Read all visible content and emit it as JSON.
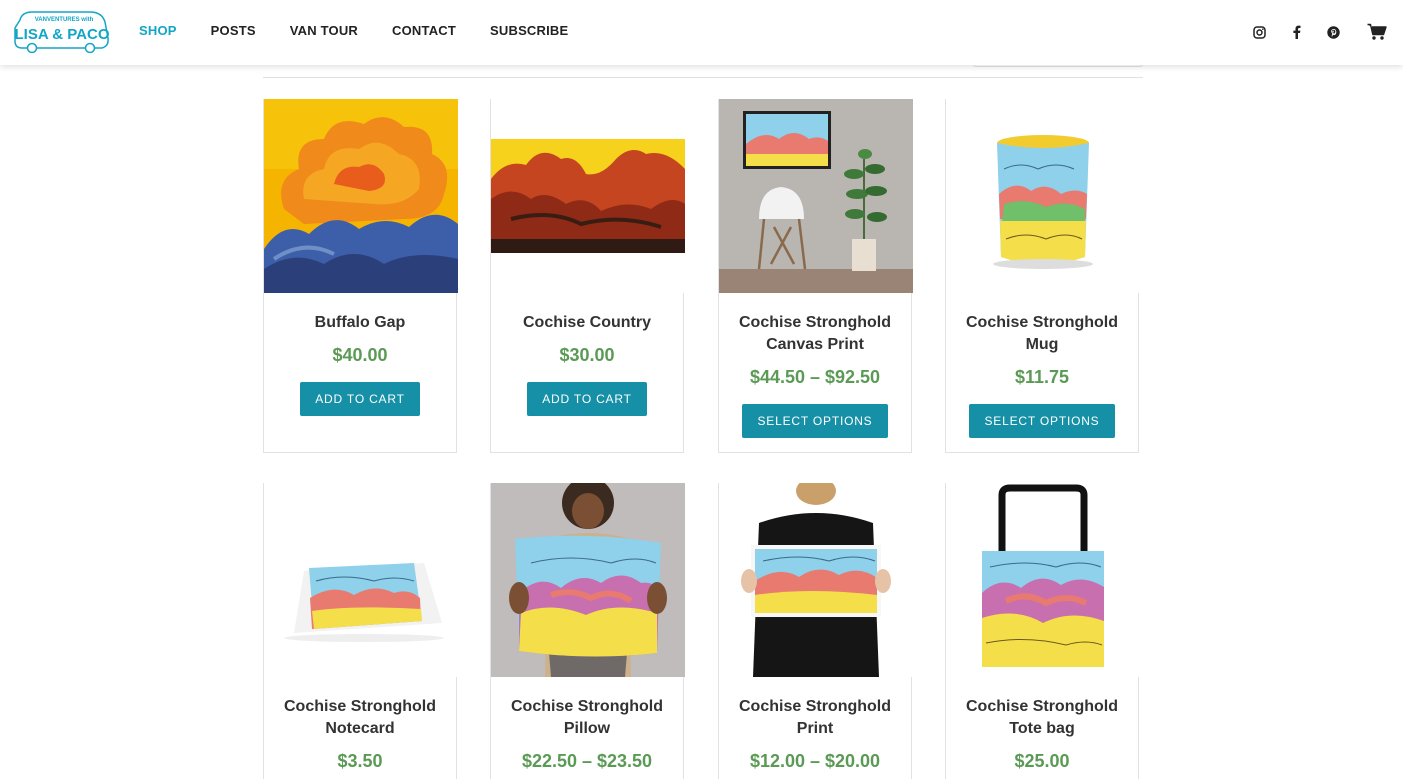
{
  "header": {
    "logo_text_top": "VANVENTURES with",
    "logo_text_main": "LISA & PACO",
    "nav": [
      {
        "label": "SHOP",
        "active": true
      },
      {
        "label": "POSTS",
        "active": false
      },
      {
        "label": "VAN TOUR",
        "active": false
      },
      {
        "label": "CONTACT",
        "active": false
      },
      {
        "label": "SUBSCRIBE",
        "active": false
      }
    ],
    "icons": [
      "instagram-icon",
      "facebook-icon",
      "pinterest-icon",
      "cart-icon"
    ]
  },
  "colors": {
    "accent": "#12a6c6",
    "button": "#1690a6",
    "price": "#5b9a55"
  },
  "products": [
    {
      "title": "Buffalo Gap",
      "price": "$40.00",
      "button": "ADD TO CART"
    },
    {
      "title": "Cochise Country",
      "price": "$30.00",
      "button": "ADD TO CART"
    },
    {
      "title": "Cochise Stronghold Canvas Print",
      "price": "$44.50 – $92.50",
      "button": "SELECT OPTIONS"
    },
    {
      "title": "Cochise Stronghold Mug",
      "price": "$11.75",
      "button": "SELECT OPTIONS"
    },
    {
      "title": "Cochise Stronghold Notecard",
      "price": "$3.50",
      "button": ""
    },
    {
      "title": "Cochise Stronghold Pillow",
      "price": "$22.50 – $23.50",
      "button": ""
    },
    {
      "title": "Cochise Stronghold Print",
      "price": "$12.00 – $20.00",
      "button": ""
    },
    {
      "title": "Cochise Stronghold Tote bag",
      "price": "$25.00",
      "button": ""
    }
  ]
}
